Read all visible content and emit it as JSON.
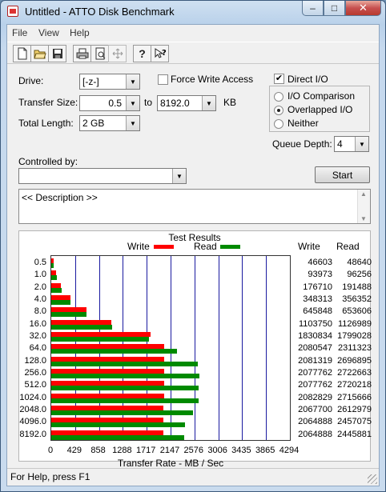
{
  "window": {
    "title": "Untitled - ATTO Disk Benchmark",
    "minimize": "–",
    "maximize": "□",
    "close": "✕"
  },
  "menu": [
    "File",
    "View",
    "Help"
  ],
  "toolbar": [
    "new-icon",
    "open-icon",
    "save-icon",
    "print-icon",
    "print-preview-icon",
    "move-icon",
    "help-icon",
    "context-help-icon"
  ],
  "form": {
    "drive_label": "Drive:",
    "drive_value": "[-z-]",
    "force_write_label": "Force Write Access",
    "force_write_checked": false,
    "transfer_size_label": "Transfer Size:",
    "transfer_from": "0.5",
    "to_label": "to",
    "transfer_to": "8192.0",
    "kb_label": "KB",
    "total_length_label": "Total Length:",
    "total_length": "2 GB",
    "direct_io_label": "Direct I/O",
    "direct_io_checked": true,
    "io_options": [
      "I/O Comparison",
      "Overlapped I/O",
      "Neither"
    ],
    "io_selected": "Overlapped I/O",
    "queue_depth_label": "Queue Depth:",
    "queue_depth": "4",
    "controlled_by_label": "Controlled by:",
    "controlled_by_value": "",
    "start_label": "Start",
    "description": "<< Description >>"
  },
  "chart_data": {
    "type": "bar",
    "title": "Test Results",
    "xlabel": "Transfer Rate - MB / Sec",
    "xlim": [
      0,
      4294
    ],
    "xticks": [
      "0",
      "429",
      "858",
      "1288",
      "1717",
      "2147",
      "2576",
      "3006",
      "3435",
      "3865",
      "4294"
    ],
    "categories": [
      "0.5",
      "1.0",
      "2.0",
      "4.0",
      "8.0",
      "16.0",
      "32.0",
      "64.0",
      "128.0",
      "256.0",
      "512.0",
      "1024.0",
      "2048.0",
      "4096.0",
      "8192.0"
    ],
    "series": [
      {
        "name": "Write",
        "color": "#ff0000",
        "values": [
          46603,
          93973,
          176710,
          348313,
          645848,
          1103750,
          1830834,
          2080547,
          2081319,
          2077762,
          2077762,
          2082829,
          2067700,
          2064888,
          2064888
        ]
      },
      {
        "name": "Read",
        "color": "#008a00",
        "values": [
          48640,
          96256,
          191488,
          356352,
          653606,
          1126989,
          1799028,
          2311323,
          2696895,
          2722663,
          2720218,
          2715666,
          2612979,
          2457075,
          2445881
        ]
      }
    ],
    "columns": [
      "Write",
      "Read"
    ]
  },
  "status": "For Help, press F1"
}
